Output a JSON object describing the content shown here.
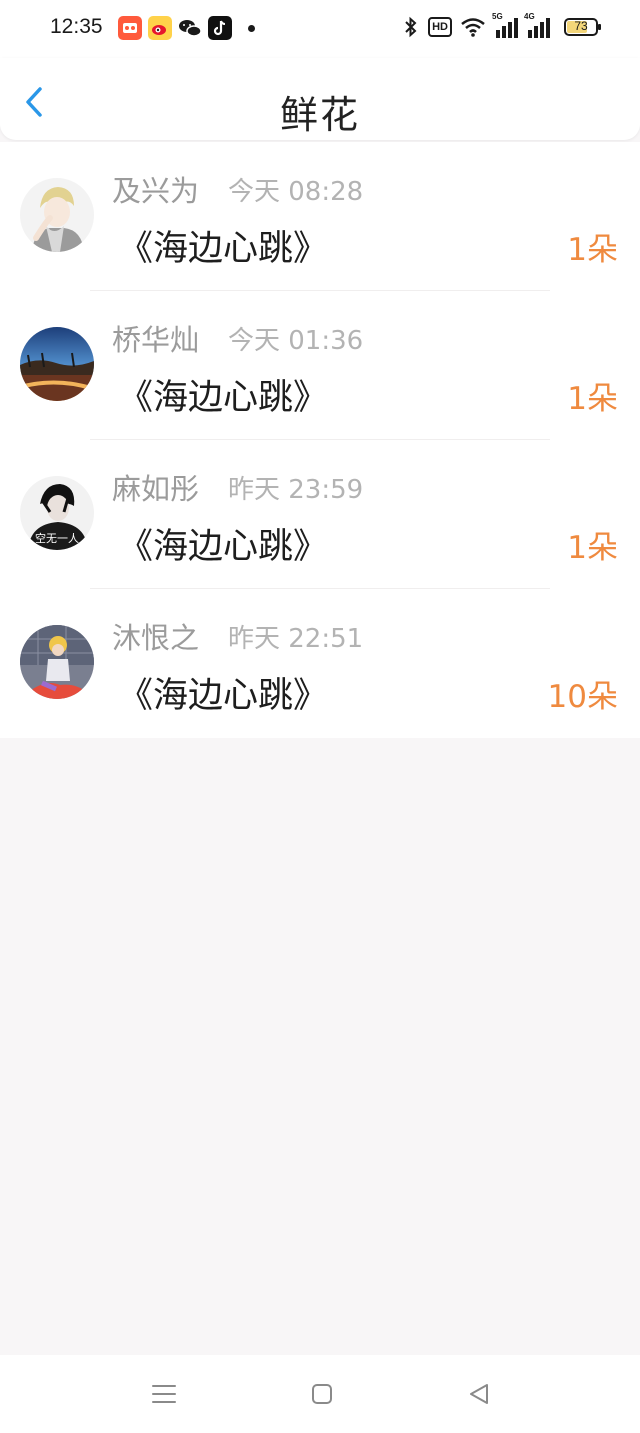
{
  "status_bar": {
    "time": "12:35",
    "app_icons": [
      "kuaishou-icon",
      "weibo-icon",
      "wechat-icon",
      "tiktok-icon"
    ],
    "hd_label": "HD",
    "signal_5g": "5G",
    "signal_4g": "4G",
    "battery": "73",
    "battery_level": 0.73
  },
  "header": {
    "title": "鲜花"
  },
  "items": [
    {
      "name": "及兴为",
      "time": "今天 08:28",
      "song": "《海边心跳》",
      "count": "1朵"
    },
    {
      "name": "桥华灿",
      "time": "今天 01:36",
      "song": "《海边心跳》",
      "count": "1朵"
    },
    {
      "name": "麻如彤",
      "time": "昨天 23:59",
      "song": "《海边心跳》",
      "count": "1朵"
    },
    {
      "name": "沐恨之",
      "time": "昨天 22:51",
      "song": "《海边心跳》",
      "count": "10朵"
    }
  ],
  "avatar3_text": "空无一人",
  "colors": {
    "accent_blue": "#2a97e8",
    "count_orange": "#ef8a3f",
    "background": "#f8f6f7"
  }
}
